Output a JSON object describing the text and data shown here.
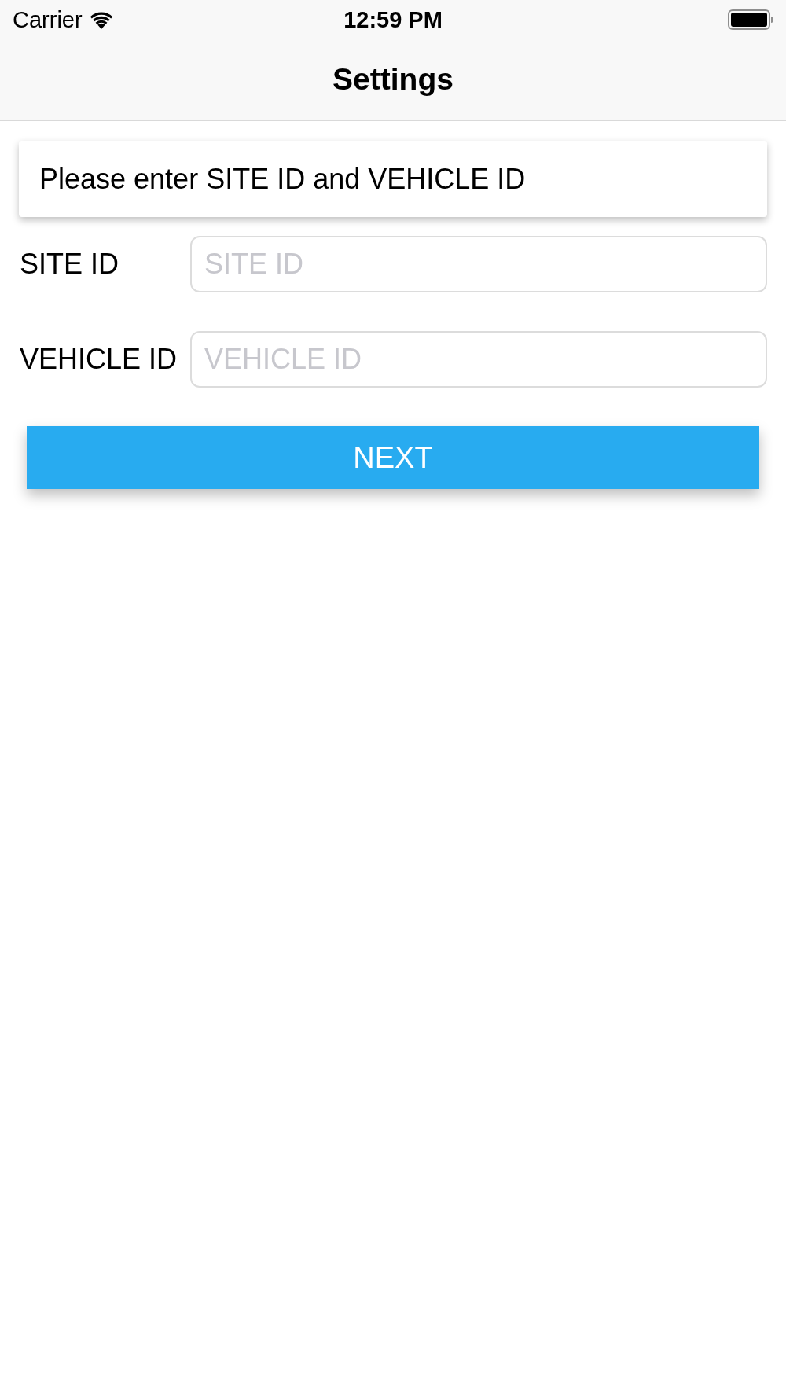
{
  "status_bar": {
    "carrier": "Carrier",
    "time": "12:59 PM"
  },
  "nav_bar": {
    "title": "Settings"
  },
  "message": "Please enter SITE ID and VEHICLE ID",
  "fields": [
    {
      "label": "SITE ID",
      "placeholder": "SITE ID"
    },
    {
      "label": "VEHICLE ID",
      "placeholder": "VEHICLE ID"
    }
  ],
  "button": {
    "label": "NEXT"
  }
}
